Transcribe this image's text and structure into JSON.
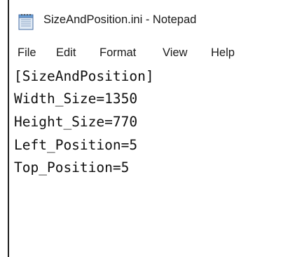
{
  "window": {
    "title": "SizeAndPosition.ini - Notepad",
    "icon": "notepad-icon"
  },
  "menu": {
    "items": [
      "File",
      "Edit",
      "Format",
      "View",
      "Help"
    ]
  },
  "editor": {
    "lines": [
      "[SizeAndPosition]",
      "Width_Size=1350",
      "Height_Size=770",
      "Left_Position=5",
      "Top_Position=5"
    ]
  },
  "colors": {
    "background": "#ffffff",
    "text": "#101010",
    "border": "#1f1f1f"
  }
}
